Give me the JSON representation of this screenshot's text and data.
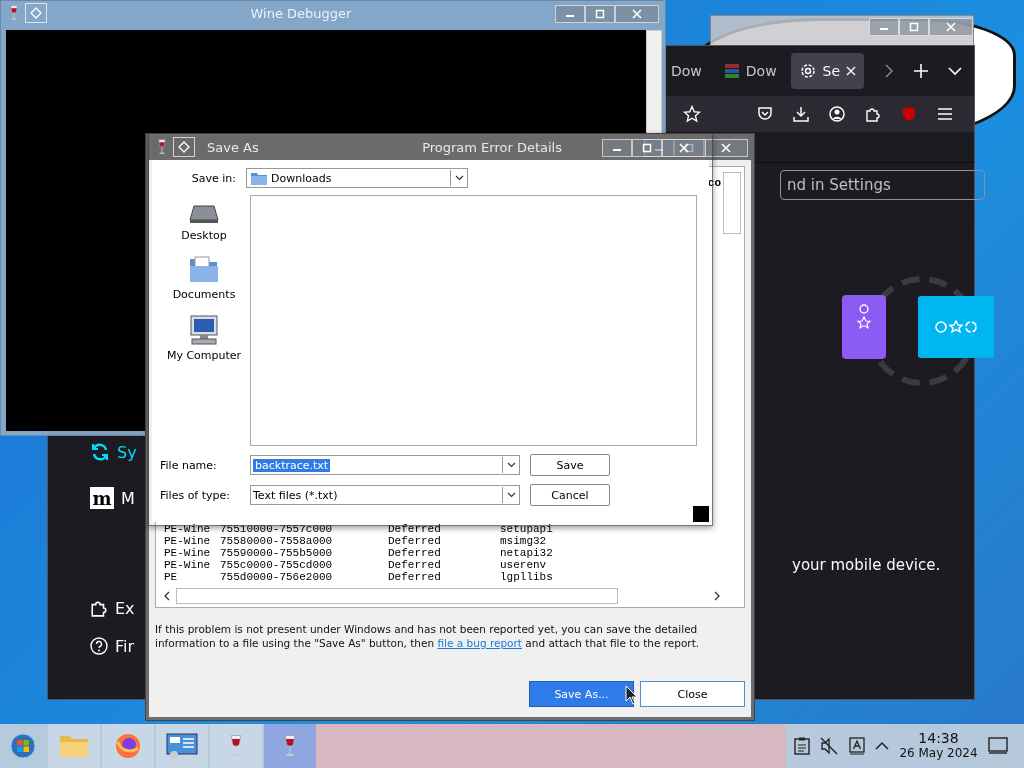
{
  "wine_debugger": {
    "title": "Wine Debugger"
  },
  "browser": {
    "tabs": [
      {
        "label": "Dow",
        "selected": false,
        "kind": "plain"
      },
      {
        "label": "Dow",
        "selected": false,
        "kind": "archive"
      },
      {
        "label": "Se",
        "selected": true,
        "kind": "settings"
      }
    ],
    "search": {
      "placeholder": "nd in Settings"
    },
    "sidebar": [
      {
        "label": "Sy",
        "kind": "sync"
      },
      {
        "label": "M",
        "kind": "mozilla",
        "logo_letter": "m"
      },
      {
        "label": "Ex",
        "kind": "extensions"
      },
      {
        "label": "Fir",
        "kind": "help"
      }
    ],
    "body_text": "your mobile device."
  },
  "error_details": {
    "title": "Program Error Details",
    "peek_text": "co",
    "modules": [
      {
        "type": "PE-Wine",
        "range": "75510000-7557c000",
        "state": "Deferred",
        "name": "setupapi"
      },
      {
        "type": "PE-Wine",
        "range": "75580000-7558a000",
        "state": "Deferred",
        "name": "msimg32"
      },
      {
        "type": "PE-Wine",
        "range": "75590000-755b5000",
        "state": "Deferred",
        "name": "netapi32"
      },
      {
        "type": "PE-Wine",
        "range": "755c0000-755cd000",
        "state": "Deferred",
        "name": "userenv"
      },
      {
        "type": "PE",
        "range": "755d0000-756e2000",
        "state": "Deferred",
        "name": "lgpllibs"
      }
    ],
    "message": "If this problem is not present under Windows and has not been reported yet, you can save the detailed information to a file using the \"Save As\" button, then",
    "link": "file a bug report",
    "message_end": "and attach that file to the report.",
    "buttons": [
      {
        "label": "Save As...",
        "selected": true
      },
      {
        "label": "Close",
        "selected": false
      }
    ]
  },
  "save_dialog": {
    "title": "Save As",
    "save_in_label": "Save in:",
    "save_in": "Downloads",
    "places": [
      {
        "label": "Desktop",
        "kind": "desktop"
      },
      {
        "label": "Documents",
        "kind": "documents"
      },
      {
        "label": "My Computer",
        "kind": "computer"
      }
    ],
    "file_name_label": "File name:",
    "file_name": "backtrace.txt",
    "file_type_label": "Files of type:",
    "file_type": "Text files (*.txt)",
    "buttons": [
      "Save",
      "Cancel"
    ]
  },
  "taskbar": {
    "apps": [
      {
        "kind": "folder",
        "selected": false
      },
      {
        "kind": "firefox",
        "selected": false
      },
      {
        "kind": "control-panel",
        "selected": false
      },
      {
        "kind": "wine",
        "selected": false
      },
      {
        "kind": "wine",
        "selected": true
      }
    ],
    "time": "14:38",
    "date": "26 May 2024"
  }
}
